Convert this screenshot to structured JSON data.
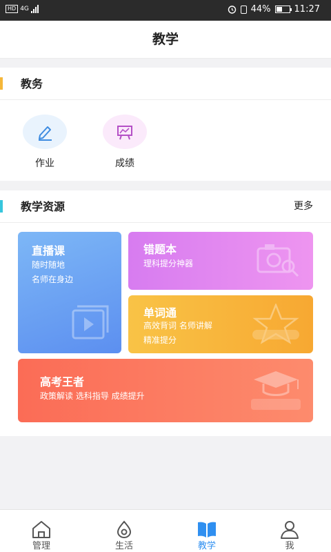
{
  "status_bar": {
    "network": "4G",
    "hd": "HD",
    "battery": "44%",
    "battery_level": 0.44,
    "time": "11:27"
  },
  "header": {
    "title": "教学"
  },
  "jiaowu": {
    "title": "教务",
    "accent": "#f5b73a",
    "items": [
      {
        "label": "作业",
        "icon": "pencil-icon",
        "bg": "#e9f3fd",
        "color": "#3d8be0"
      },
      {
        "label": "成绩",
        "icon": "chart-board-icon",
        "bg": "#fbeafb",
        "color": "#b44fc6"
      }
    ]
  },
  "resources": {
    "title": "教学资源",
    "more": "更多",
    "accent": "#37c6dd",
    "cards": {
      "live": {
        "title": "直播课",
        "sub1": "随时随地",
        "sub2": "名师在身边",
        "color_from": "#7db7f6",
        "color_to": "#5c8ff0"
      },
      "mistakes": {
        "title": "错题本",
        "sub": "理科提分神器",
        "badge": "",
        "color_from": "#d77cf0",
        "color_to": "#ee95f0"
      },
      "words": {
        "title": "单词通",
        "sub1": "高效背词  名师讲解",
        "sub2": "精准提分",
        "badge": "高考单词通",
        "color_from": "#f9c346",
        "color_to": "#f7a832"
      },
      "gaokao": {
        "title": "高考王者",
        "sub": "政策解读  选科指导  成绩提升",
        "badge": "高考王者",
        "color_from": "#fb6c56",
        "color_to": "#fd8b6d"
      }
    }
  },
  "tabbar": {
    "active_color": "#2f8ff0",
    "items": [
      {
        "label": "管理",
        "icon": "house-icon"
      },
      {
        "label": "生活",
        "icon": "drop-icon"
      },
      {
        "label": "教学",
        "icon": "book-icon"
      },
      {
        "label": "我",
        "icon": "person-icon"
      }
    ]
  }
}
